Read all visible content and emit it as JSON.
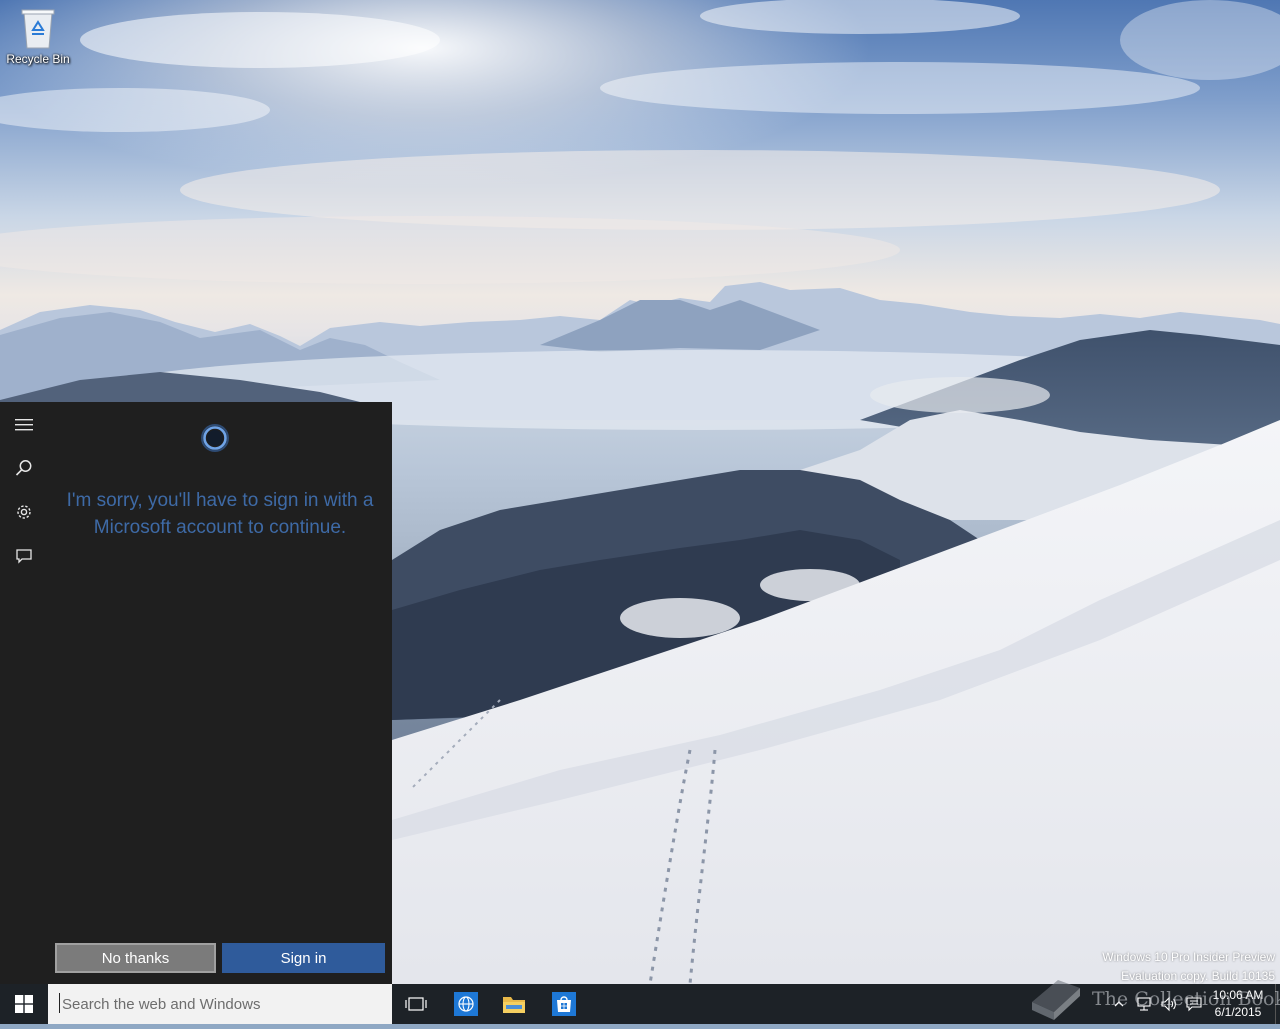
{
  "desktop": {
    "icons": [
      {
        "label": "Recycle Bin",
        "icon": "recycle-bin-icon"
      }
    ]
  },
  "cortana": {
    "rail": [
      {
        "name": "hamburger-menu",
        "icon": "hamburger-icon"
      },
      {
        "name": "search",
        "icon": "search-icon"
      },
      {
        "name": "settings",
        "icon": "gear-icon"
      },
      {
        "name": "feedback",
        "icon": "feedback-icon"
      }
    ],
    "message": "I'm sorry, you'll have to sign in with a Microsoft account to continue.",
    "no_thanks_label": "No thanks",
    "sign_in_label": "Sign in",
    "colors": {
      "panel_bg": "#1f1f1f",
      "message": "#3e6aa6",
      "sign_in_bg": "#2f5b9b",
      "no_thanks_bg": "#7b7b7b"
    }
  },
  "taskbar": {
    "search_placeholder": "Search the web and Windows",
    "apps": [
      {
        "name": "task-view",
        "icon": "task-view-icon"
      },
      {
        "name": "browser",
        "icon": "globe-icon"
      },
      {
        "name": "file-explorer",
        "icon": "folder-icon"
      },
      {
        "name": "store",
        "icon": "store-icon"
      }
    ],
    "tray_icons": [
      "chevron-up-icon",
      "network-icon",
      "volume-icon",
      "action-center-icon"
    ],
    "time": "10:06 AM",
    "date": "6/1/2015"
  },
  "watermark": {
    "line1": "Windows 10 Pro Insider Preview",
    "line2": "Evaluation copy. Build 10135",
    "site": "The Collection Book"
  }
}
